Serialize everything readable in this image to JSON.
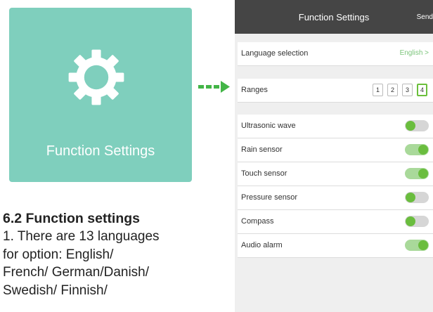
{
  "tile": {
    "label": "Function Settings",
    "icon": "gear-icon",
    "background": "#7fcfbd"
  },
  "manual": {
    "heading": "6.2 Function settings",
    "body_lines": [
      "1. There are 13 languages",
      "for option: English/",
      "French/ German/Danish/",
      "Swedish/ Finnish/"
    ]
  },
  "app": {
    "title": "Function Settings",
    "send_label": "Send",
    "language": {
      "label": "Language selection",
      "value": "English >"
    },
    "ranges": {
      "label": "Ranges",
      "options": [
        "1",
        "2",
        "3",
        "4"
      ],
      "selected": "4"
    },
    "toggles": [
      {
        "label": "Ultrasonic wave",
        "state": "off"
      },
      {
        "label": "Rain sensor",
        "state": "on"
      },
      {
        "label": "Touch sensor",
        "state": "on"
      },
      {
        "label": "Pressure sensor",
        "state": "off"
      },
      {
        "label": "Compass",
        "state": "off"
      },
      {
        "label": "Audio alarm",
        "state": "on"
      }
    ],
    "colors": {
      "accent": "#6abd3e",
      "header": "#454545",
      "link": "#7bc47a"
    }
  }
}
